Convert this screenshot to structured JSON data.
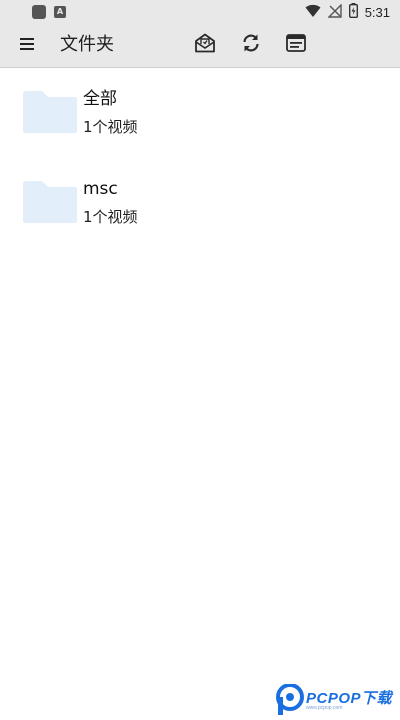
{
  "status_bar": {
    "left_label": "",
    "time": "5:31",
    "icons": [
      "notification-square-icon",
      "notification-a-icon",
      "wifi-icon",
      "no-signal-icon",
      "battery-icon"
    ],
    "notif_a": "A"
  },
  "app_bar": {
    "title": "文件夹",
    "menu_icon": "hamburger-menu-icon",
    "actions": [
      "mail-icon",
      "refresh-icon",
      "list-view-icon"
    ]
  },
  "folders": [
    {
      "name": "全部",
      "count": "1个视频"
    },
    {
      "name": "msc",
      "count": "1个视频"
    }
  ],
  "colors": {
    "bar_background": "#e8e8e8",
    "folder_icon": "#e3eefb",
    "text_primary": "#111111",
    "watermark_blue": "#1a6fe0"
  },
  "watermark": {
    "brand": "PCPOP下载",
    "sub": "www.pcpop.com"
  }
}
